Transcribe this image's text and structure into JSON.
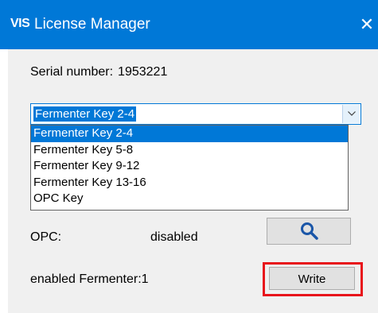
{
  "window": {
    "logo": "VIS",
    "title": "License Manager",
    "close_icon": "close-icon",
    "accent": "#0078d7"
  },
  "serial": {
    "label": "Serial number:",
    "value": "1953221"
  },
  "key_combo": {
    "selected": "Fermenter Key 2-4",
    "arrow_icon": "chevron-down-icon",
    "options": [
      "Fermenter Key 2-4",
      "Fermenter Key 5-8",
      "Fermenter Key 9-12",
      "Fermenter Key 13-16",
      "OPC Key"
    ]
  },
  "opc": {
    "label": "OPC:",
    "value": "disabled",
    "search_icon": "search-icon"
  },
  "fermenter": {
    "label": "enabled Fermenter:",
    "value": "1"
  },
  "write_button": {
    "label": "Write",
    "highlight_color": "#e8141b"
  }
}
